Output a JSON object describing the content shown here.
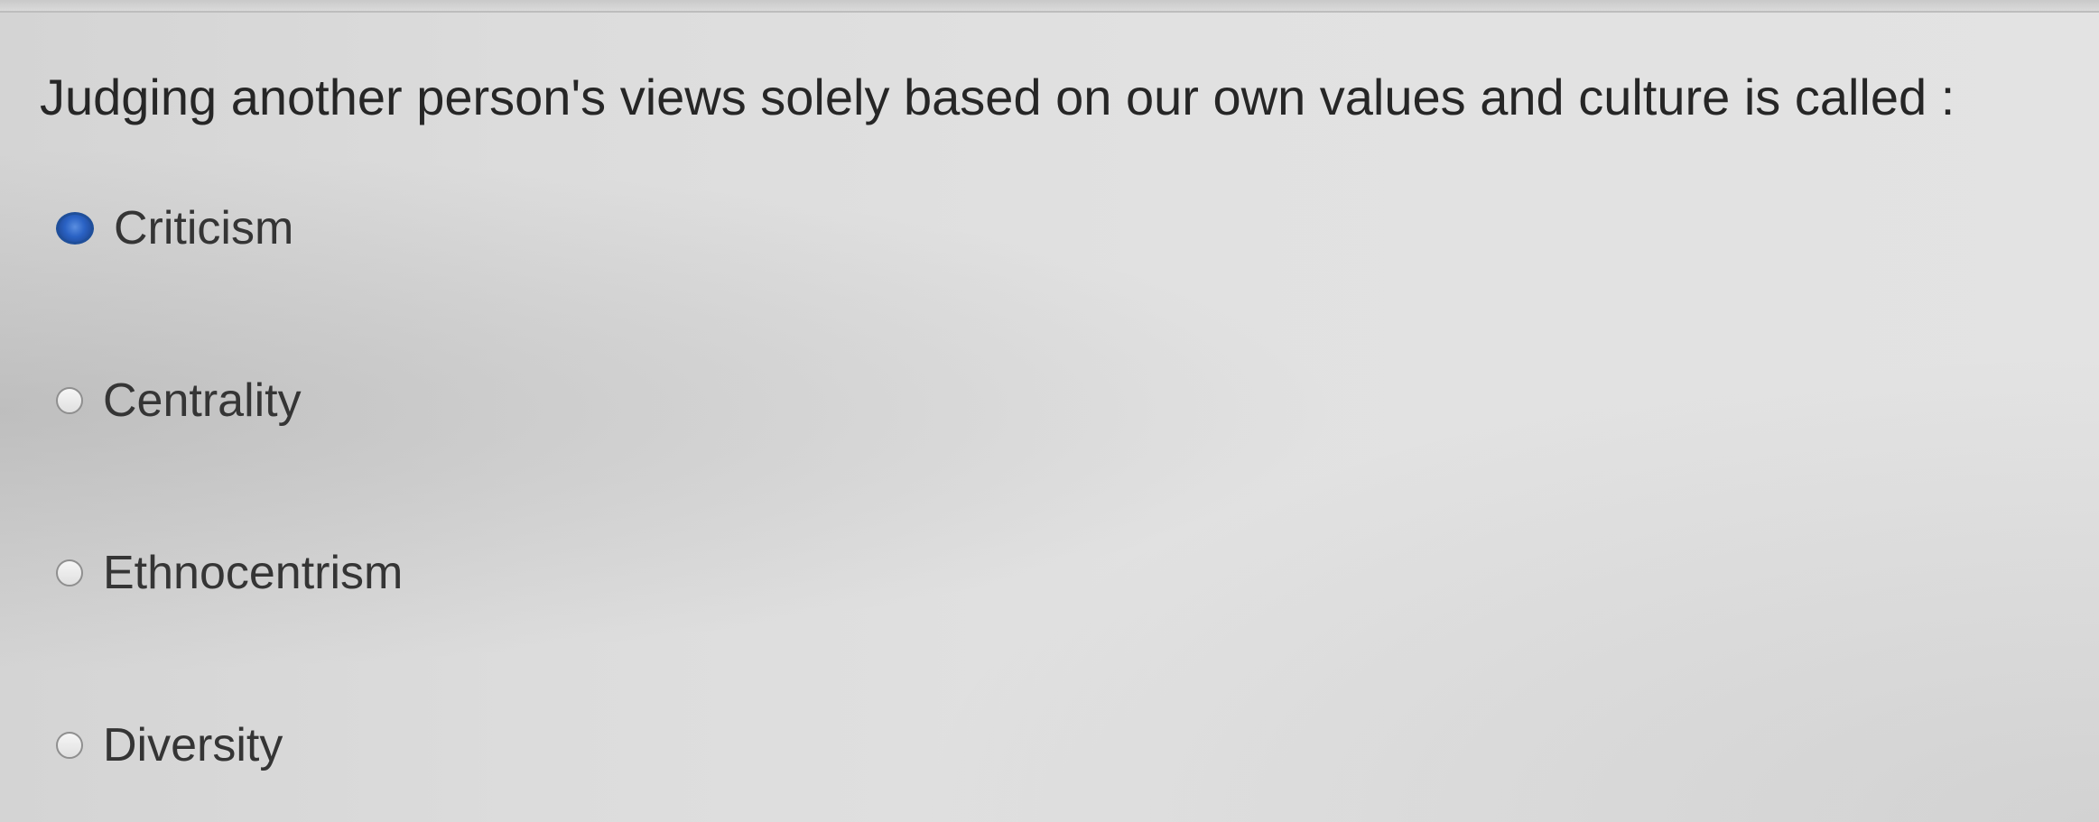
{
  "question": {
    "text": "Judging another person's views solely based on our own values and culture is called :"
  },
  "options": [
    {
      "label": "Criticism",
      "selected": true
    },
    {
      "label": "Centrality",
      "selected": false
    },
    {
      "label": "Ethnocentrism",
      "selected": false
    },
    {
      "label": "Diversity",
      "selected": false
    }
  ],
  "colors": {
    "selected_radio": "#2a62c4",
    "unselected_radio_border": "#8f8f8f",
    "text": "#262626"
  }
}
